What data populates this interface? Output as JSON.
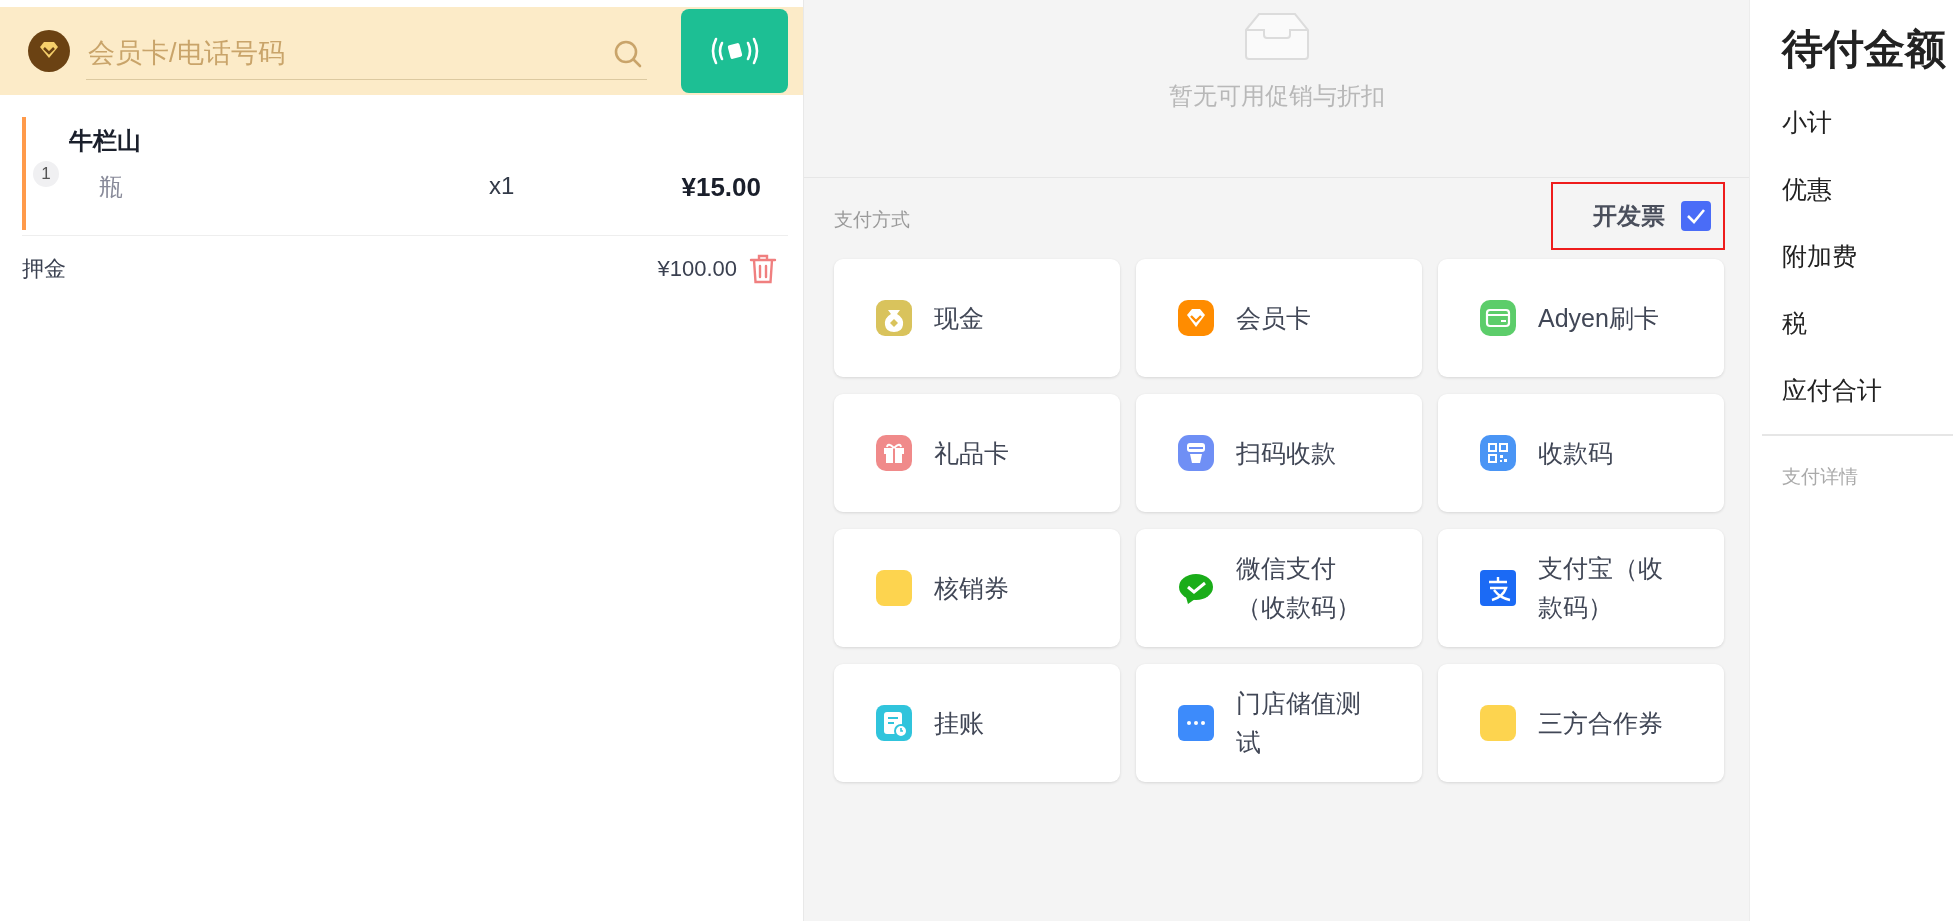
{
  "member_search": {
    "placeholder": "会员卡/电话号码"
  },
  "order_items": [
    {
      "index": "1",
      "name": "牛栏山",
      "unit": "瓶",
      "quantity": "x1",
      "price": "¥15.00",
      "selected": true
    }
  ],
  "deposit": {
    "label": "押金",
    "amount": "¥100.00"
  },
  "promotions": {
    "empty_text": "暂无可用促销与折扣"
  },
  "payment": {
    "title": "支付方式",
    "invoice": {
      "label": "开发票",
      "checked": true,
      "highlighted": true
    },
    "methods": [
      {
        "label": "现金",
        "kind": "cash",
        "color": "#d9c35c"
      },
      {
        "label": "会员卡",
        "kind": "member",
        "color": "#ff8c00"
      },
      {
        "label": "Adyen刷卡",
        "kind": "card",
        "color": "#5ccd6a"
      },
      {
        "label": "礼品卡",
        "kind": "gift",
        "color": "#f08a8a"
      },
      {
        "label": "扫码收款",
        "kind": "scanner",
        "color": "#6f8ff5"
      },
      {
        "label": "收款码",
        "kind": "qr",
        "color": "#4a95f5"
      },
      {
        "label": "核销券",
        "kind": "plain",
        "color": "#fdd44f"
      },
      {
        "label": "微信支付（收款码）",
        "kind": "chat",
        "color": "#1aad19"
      },
      {
        "label": "支付宝（收款码）",
        "kind": "pay",
        "color": "#1b6af5"
      },
      {
        "label": "挂账",
        "kind": "ledger",
        "color": "#30c4dc"
      },
      {
        "label": "门店储值测试",
        "kind": "more",
        "color": "#3d8bfb"
      },
      {
        "label": "三方合作券",
        "kind": "plain",
        "color": "#fdd44f"
      }
    ]
  },
  "summary": {
    "title": "待付金额",
    "rows": [
      "小计",
      "优惠",
      "附加费",
      "税",
      "应付合计"
    ],
    "details_label": "支付详情"
  }
}
